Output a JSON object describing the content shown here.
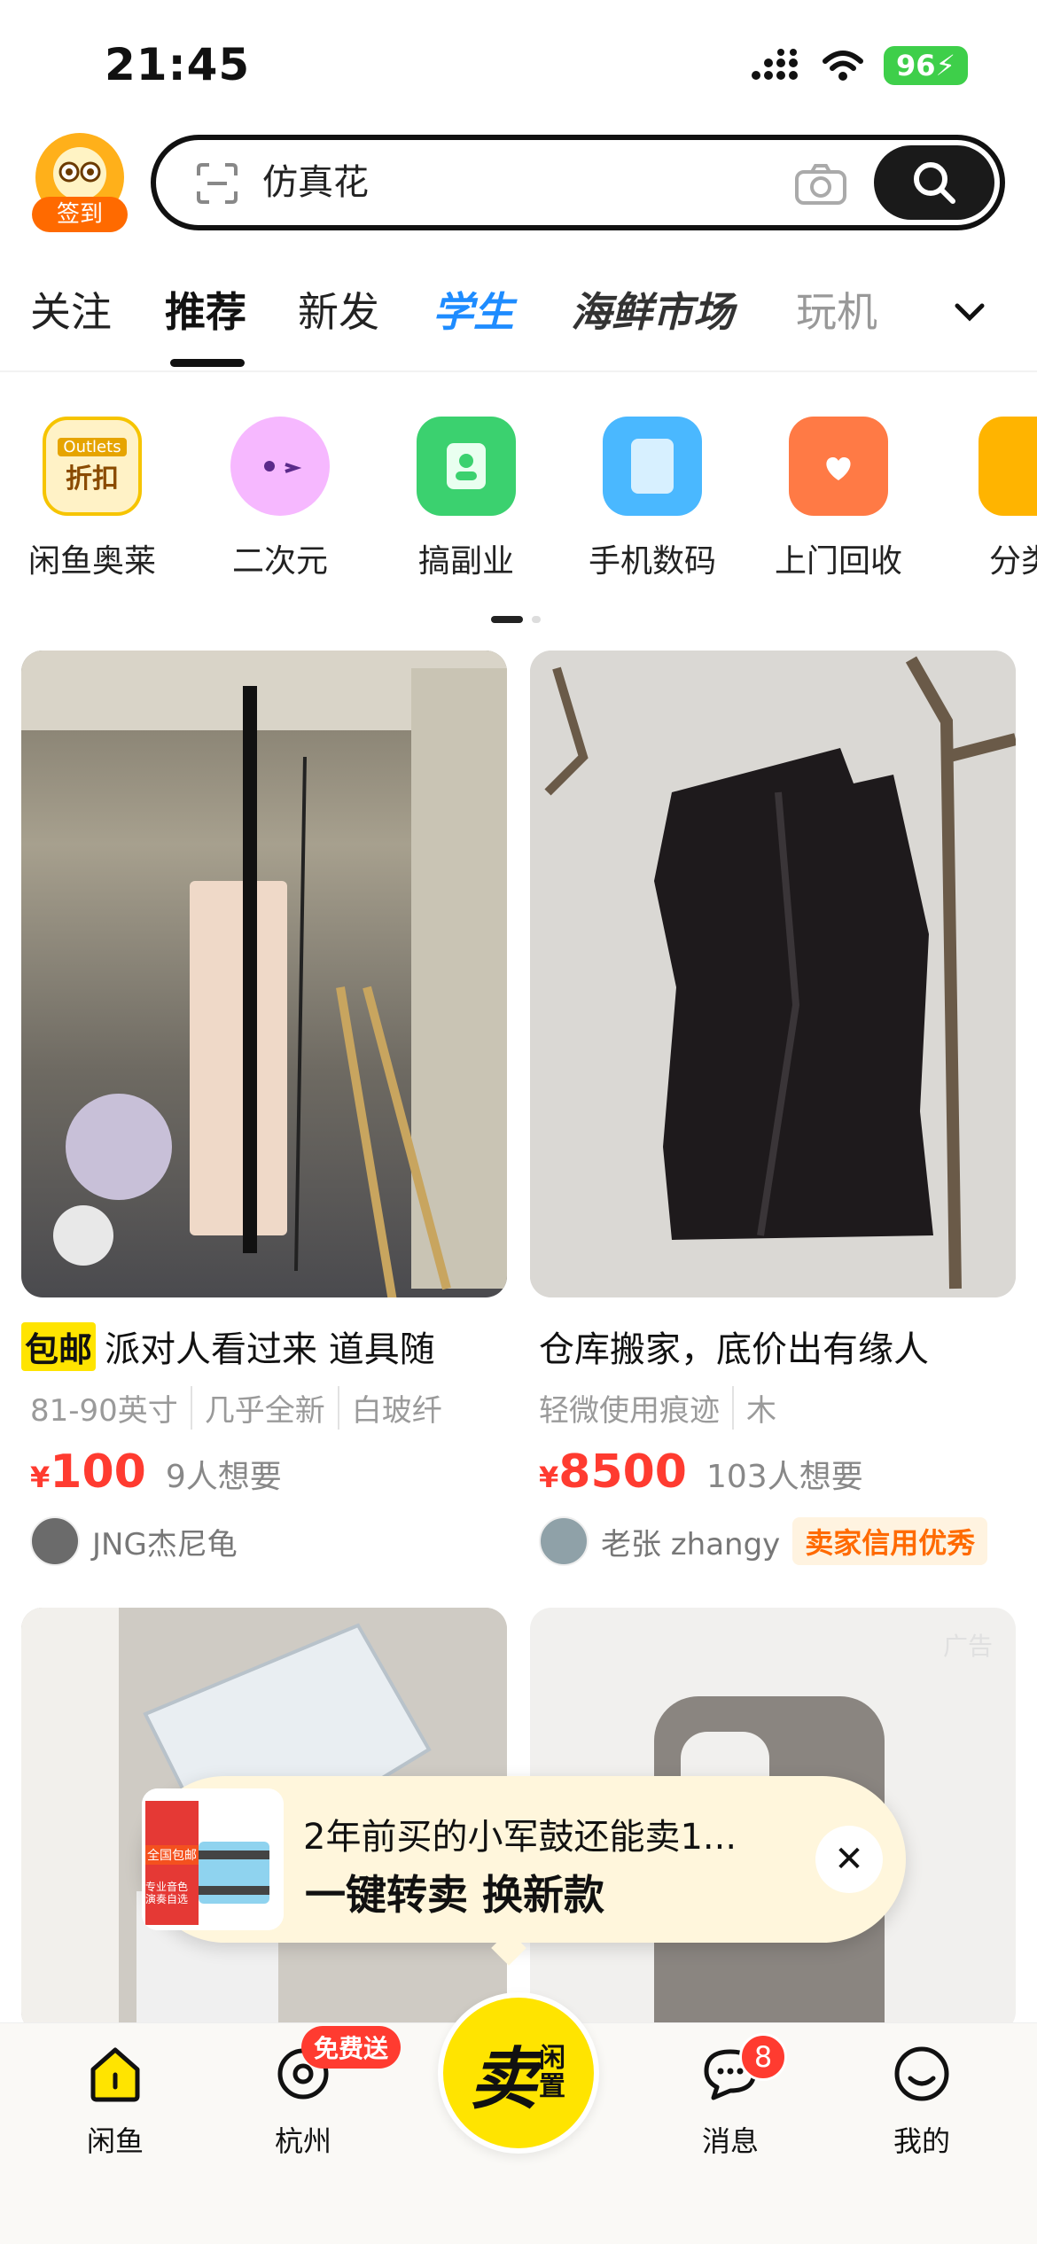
{
  "status_bar": {
    "time": "21:45",
    "battery": "96"
  },
  "search": {
    "sign_in_label": "签到",
    "query": "仿真花"
  },
  "tabs": [
    {
      "label": "关注"
    },
    {
      "label": "推荐"
    },
    {
      "label": "新发"
    },
    {
      "label": "学生"
    },
    {
      "label": "海鲜市场"
    },
    {
      "label": "玩机"
    }
  ],
  "categories": [
    {
      "label": "闲鱼奥莱",
      "icon": "outlets-discount-icon",
      "icon_text_top": "Outlets",
      "icon_text": "折扣"
    },
    {
      "label": "二次元",
      "icon": "anime-cat-icon"
    },
    {
      "label": "搞副业",
      "icon": "id-badge-icon"
    },
    {
      "label": "手机数码",
      "icon": "tablet-icon"
    },
    {
      "label": "上门回收",
      "icon": "recycle-bag-icon"
    },
    {
      "label": "分类",
      "icon": "grid-icon"
    }
  ],
  "feed": [
    {
      "free_shipping": "包邮",
      "title": "派对人看过来 道具随",
      "tags": [
        "81-90英寸",
        "几乎全新",
        "白玻纤"
      ],
      "currency": "¥",
      "price": "100",
      "wants": "9人想要",
      "seller": "JNG杰尼龟"
    },
    {
      "title": "仓库搬家，底价出有缘人",
      "tags": [
        "轻微使用痕迹",
        "木"
      ],
      "currency": "¥",
      "price": "8500",
      "wants": "103人想要",
      "seller": "老张 zhangy",
      "seller_badge": "卖家信用优秀"
    },
    {
      "ad_label": "广告"
    }
  ],
  "promo": {
    "line1": "2年前买的小军鼓还能卖1...",
    "line2": "一键转卖 换新款",
    "thumb_tags": [
      "全国包邮",
      "专业音色 演奏自选"
    ]
  },
  "bottom_nav": {
    "home": "闲鱼",
    "city": "杭州",
    "city_badge": "免费送",
    "sell_big": "卖",
    "sell_small": "闲置",
    "messages": "消息",
    "messages_count": "8",
    "me": "我的"
  },
  "colors": {
    "accent_yellow": "#ffe400",
    "price_red": "#ff3b30",
    "student_blue": "#1e8cff"
  }
}
